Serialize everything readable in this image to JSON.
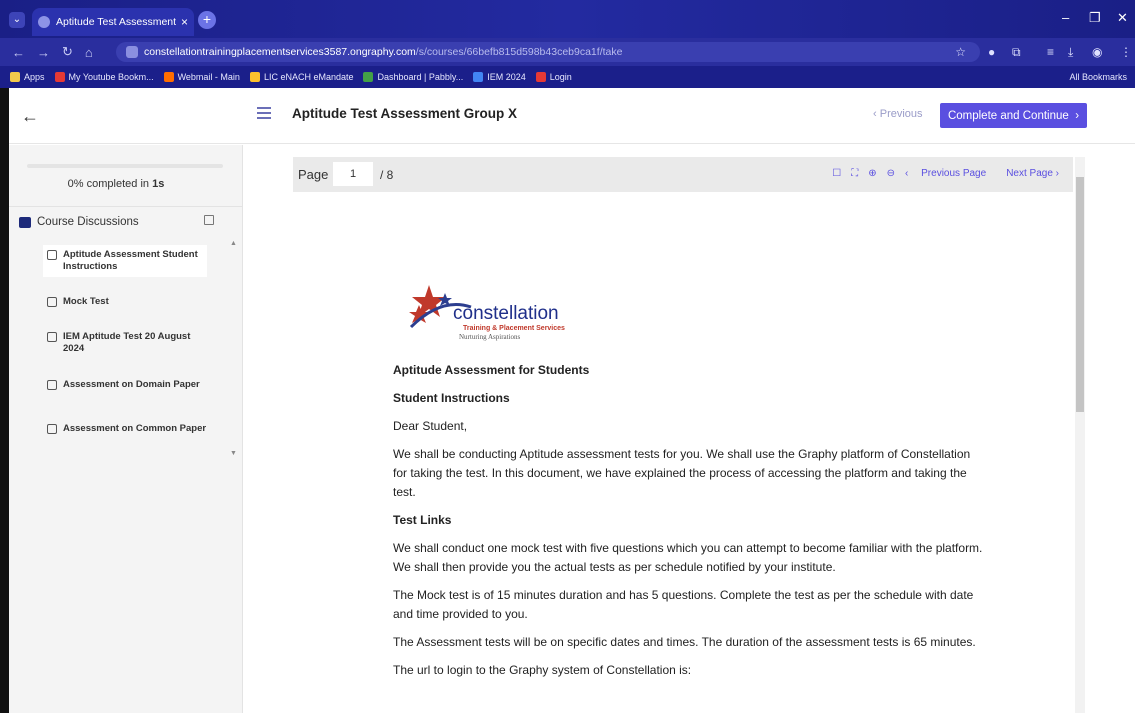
{
  "browser": {
    "tab_title": "Aptitude Test Assessment Grou",
    "url_host": "constellationtrainingplacementservices3587.ongraphy.com",
    "url_path": "/s/courses/66befb815d598b43ceb9ca1f/take",
    "bookmarks": [
      {
        "label": "Apps",
        "color": "#f2c94c"
      },
      {
        "label": "My Youtube Bookm...",
        "color": "#e53935"
      },
      {
        "label": "Webmail - Main",
        "color": "#ff6d00"
      },
      {
        "label": "LIC eNACH eMandate",
        "color": "#fbc02d"
      },
      {
        "label": "Dashboard | Pabbly...",
        "color": "#43a047"
      },
      {
        "label": "IEM 2024",
        "color": "#4285f4"
      },
      {
        "label": "Login",
        "color": "#e53935"
      }
    ],
    "all_bookmarks": "All Bookmarks"
  },
  "header": {
    "course_title": "Aptitude Test Assessment Group X",
    "previous": "Previous",
    "complete": "Complete and Continue"
  },
  "sidebar": {
    "progress_percent": "0%",
    "progress_rest": "completed in",
    "progress_time": "1s",
    "progress_fraction": 0,
    "discussions": "Course Discussions",
    "lessons": [
      {
        "label": "Aptitude Assessment Student Instructions",
        "icon": "document-icon",
        "active": true
      },
      {
        "label": "Mock Test",
        "icon": "quiz-icon",
        "active": false
      },
      {
        "label": "IEM Aptitude Test 20 August 2024",
        "icon": "document-icon",
        "active": false
      },
      {
        "label": "Assessment on Domain Paper",
        "icon": "document-icon",
        "active": false
      },
      {
        "label": "Assessment on Common Paper",
        "icon": "document-icon",
        "active": false
      }
    ]
  },
  "viewer": {
    "page_label": "Page",
    "page_current": "1",
    "page_total": "/ 8",
    "previous_page": "Previous Page",
    "next_page": "Next Page"
  },
  "document": {
    "logo_name": "constellation",
    "logo_sub1": "Training & Placement Services",
    "logo_sub2": "Nurturing Aspirations",
    "heading": "Aptitude Assessment for Students",
    "subheading": "Student Instructions",
    "greeting": "Dear Student,",
    "para1": "We shall be conducting Aptitude assessment tests for you. We shall use the Graphy platform of Constellation for taking the test. In this document, we have explained the process of accessing the platform and taking the test.",
    "links_heading": "Test Links",
    "para2": "We shall conduct one mock test with five questions which you can attempt to become familiar with the platform. We shall then provide you the actual tests as per schedule notified by your institute.",
    "para3": "The Mock test is of 15 minutes duration and has 5 questions. Complete the test as per the schedule with date and time provided to you.",
    "para4": "The Assessment tests will be on specific dates and times. The duration of the assessment tests is 65 minutes.",
    "para5": "The url to login to the Graphy system of Constellation is:"
  }
}
